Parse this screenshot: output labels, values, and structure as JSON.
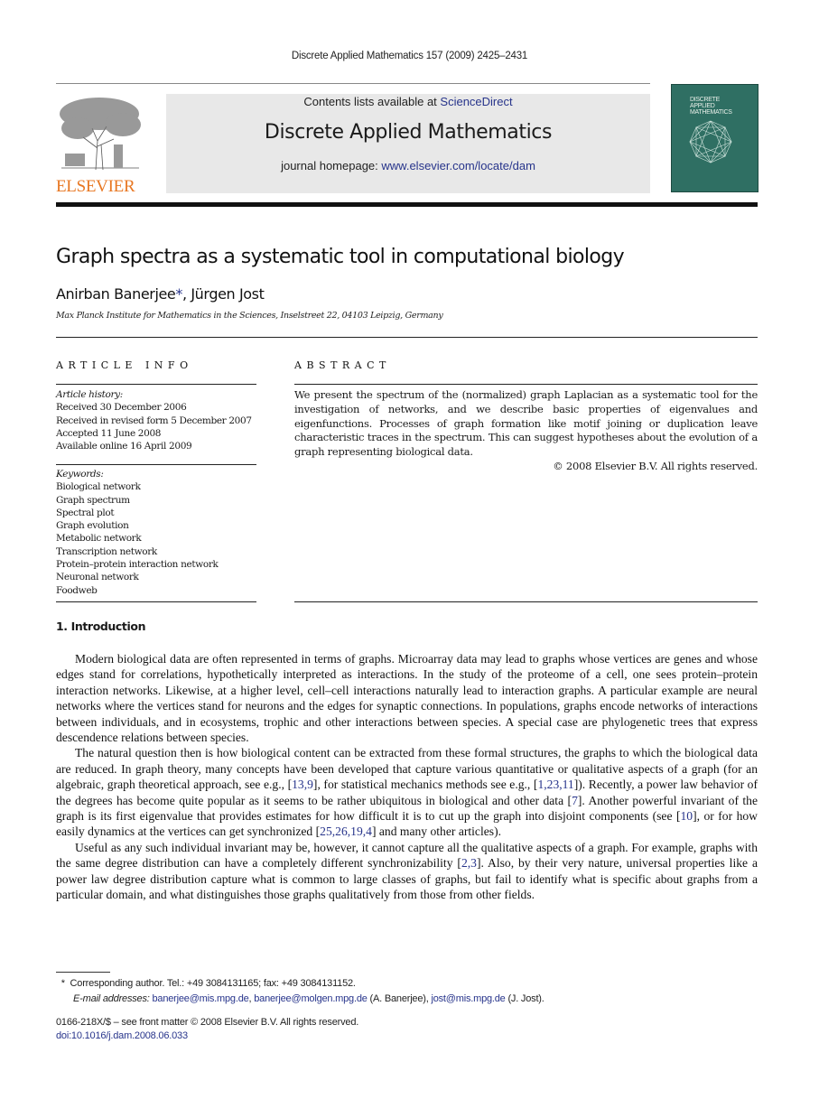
{
  "running_head": "Discrete Applied Mathematics 157 (2009) 2425–2431",
  "publisher": {
    "logo_icon": "elsevier-tree-logo",
    "name": "ELSEVIER",
    "brand_color": "#e87722"
  },
  "banner": {
    "contents_prefix": "Contents lists available at ",
    "contents_link": "ScienceDirect",
    "journal_name": "Discrete Applied Mathematics",
    "homepage_prefix": "journal homepage: ",
    "homepage_link": "www.elsevier.com/locate/dam"
  },
  "cover": {
    "line1": "DISCRETE",
    "line2": "APPLIED",
    "line3": "MATHEMATICS",
    "color": "#2f6f63"
  },
  "article": {
    "title": "Graph spectra as a systematic tool in computational biology",
    "author1": "Anirban Banerjee",
    "author_mark": "*",
    "author_sep": ", ",
    "author2": "Jürgen Jost",
    "affiliation": "Max Planck Institute for Mathematics in the Sciences, Inselstreet 22, 04103 Leipzig, Germany"
  },
  "article_info": {
    "heading": "ARTICLE INFO",
    "history_label": "Article history:",
    "history": [
      "Received 30 December 2006",
      "Received in revised form 5 December 2007",
      "Accepted 11 June 2008",
      "Available online 16 April 2009"
    ],
    "keywords_label": "Keywords:",
    "keywords": [
      "Biological network",
      "Graph spectrum",
      "Spectral plot",
      "Graph evolution",
      "Metabolic network",
      "Transcription network",
      "Protein–protein interaction network",
      "Neuronal network",
      "Foodweb"
    ]
  },
  "abstract": {
    "heading": "ABSTRACT",
    "text": "We present the spectrum of the (normalized) graph Laplacian as a systematic tool for the investigation of networks, and we describe basic properties of eigenvalues and eigenfunctions. Processes of graph formation like motif joining or duplication leave characteristic traces in the spectrum. This can suggest hypotheses about the evolution of a graph representing biological data.",
    "copyright": "© 2008 Elsevier B.V. All rights reserved."
  },
  "introduction": {
    "heading": "1.  Introduction",
    "p1": "Modern biological data are often represented in terms of graphs. Microarray data may lead to graphs whose vertices are genes and whose edges stand for correlations, hypothetically interpreted as interactions. In the study of the proteome of a cell, one sees protein–protein interaction networks. Likewise, at a higher level, cell–cell interactions naturally lead to interaction graphs. A particular example are neural networks where the vertices stand for neurons and the edges for synaptic connections. In populations, graphs encode networks of interactions between individuals, and in ecosystems, trophic and other interactions between species. A special case are phylogenetic trees that express descendence relations between species.",
    "p2": {
      "a": "The natural question then is how biological content can be extracted from these formal structures, the graphs to which the biological data are reduced. In graph theory, many concepts have been developed that capture various quantitative or qualitative aspects of a graph (for an algebraic, graph theoretical approach, see e.g., [",
      "ref1": "13,9",
      "b": "], for statistical mechanics methods see e.g., [",
      "ref2": "1,23,11",
      "c": "]). Recently, a power law behavior of the degrees has become quite popular as it seems to be rather ubiquitous in biological and other data [",
      "ref3": "7",
      "d": "]. Another powerful invariant of the graph is its first eigenvalue that provides estimates for how difficult it is to cut up the graph into disjoint components (see [",
      "ref4": "10",
      "e": "], or for how easily dynamics at the vertices can get synchronized [",
      "ref5": "25,26,19,4",
      "f": "] and many other articles)."
    },
    "p3": {
      "a": "Useful as any such individual invariant may be, however, it cannot capture all the qualitative aspects of a graph. For example, graphs with the same degree distribution can have a completely different synchronizability [",
      "ref1": "2,3",
      "b": "]. Also, by their very nature, universal properties like a power law degree distribution capture what is common to large classes of graphs, but fail to identify what is specific about graphs from a particular domain, and what distinguishes those graphs qualitatively from those from other fields."
    }
  },
  "footnote": {
    "mark": "*",
    "corresponding": "Corresponding author. Tel.: +49 3084131165; fax: +49 3084131152.",
    "email_label": "E-mail addresses:",
    "email1": "banerjee@mis.mpg.de",
    "sep1": ", ",
    "email2": "banerjee@molgen.mpg.de",
    "who1": " (A. Banerjee), ",
    "email3": "jost@mis.mpg.de",
    "who2": " (J. Jost)."
  },
  "footer": {
    "issn": "0166-218X/$ – see front matter © 2008 Elsevier B.V. All rights reserved.",
    "doi": "doi:10.1016/j.dam.2008.06.033"
  }
}
